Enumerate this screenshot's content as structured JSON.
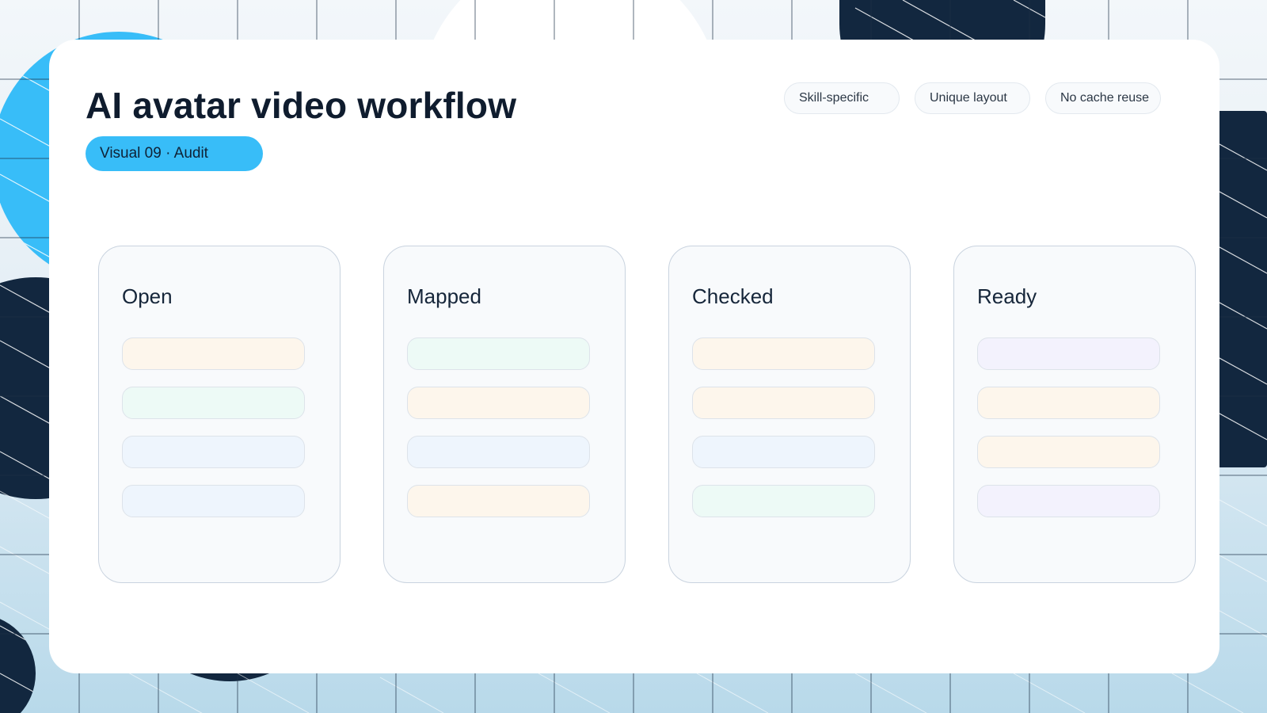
{
  "colors": {
    "accent": "#38bdf8",
    "navy": "#12273f",
    "title_text": "#0f1c2e",
    "card_background": "#ffffff",
    "column_background": "#f8fafc",
    "column_border": "#c9d3df",
    "item_peach": "#fdf6ec",
    "item_mint": "#edfaf6",
    "item_blue": "#eef5fd",
    "item_lavender": "#f3f2fd"
  },
  "header": {
    "title": "AI avatar video workflow",
    "badge": "Visual 09 · Audit"
  },
  "tags": [
    "Skill-specific",
    "Unique layout",
    "No cache reuse"
  ],
  "columns": [
    {
      "title": "Open",
      "items": [
        "peach",
        "mint",
        "blue",
        "blue"
      ]
    },
    {
      "title": "Mapped",
      "items": [
        "mint",
        "peach",
        "blue",
        "peach"
      ]
    },
    {
      "title": "Checked",
      "items": [
        "peach",
        "peach",
        "blue",
        "mint"
      ]
    },
    {
      "title": "Ready",
      "items": [
        "lavender",
        "peach",
        "peach",
        "lavender"
      ]
    }
  ]
}
